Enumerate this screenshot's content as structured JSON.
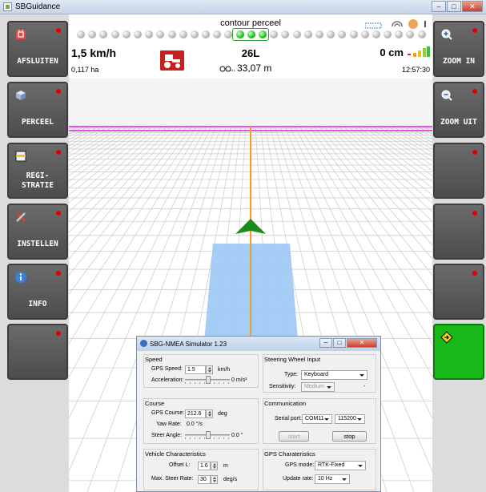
{
  "window": {
    "title": "SBGuidance",
    "min": "–",
    "max": "□",
    "close": "✕"
  },
  "left_buttons": [
    {
      "label": "AFSLUITEN",
      "icon": "exit-icon"
    },
    {
      "label": "PERCEEL",
      "icon": "field-icon"
    },
    {
      "label": "REGI-\nSTRATIE",
      "icon": "register-icon"
    },
    {
      "label": "INSTELLEN",
      "icon": "settings-icon"
    },
    {
      "label": "INFO",
      "icon": "info-icon"
    },
    {
      "label": "",
      "icon": ""
    }
  ],
  "right_buttons": [
    {
      "label": "ZOOM IN",
      "icon": "zoom-in-icon"
    },
    {
      "label": "ZOOM UIT",
      "icon": "zoom-out-icon"
    },
    {
      "label": "",
      "icon": ""
    },
    {
      "label": "",
      "icon": ""
    },
    {
      "label": "",
      "icon": ""
    },
    {
      "label": "",
      "icon": "arrow-diamond-icon",
      "color": "#18b818"
    }
  ],
  "status": {
    "mode_title": "contour perceel",
    "speed": "1,5 km/h",
    "area": "0,117 ha",
    "lane": "26L",
    "distance": "33,07 m",
    "offset": "0 cm",
    "time": "12:57:30",
    "leds_total": 31,
    "leds_active": [
      14,
      15,
      16
    ]
  },
  "colors": {
    "boundary": "#e020e0",
    "guide_line": "#f0a020",
    "coverage": "#9cc8f4",
    "vehicle": "#1d8a1d",
    "button_bg": "#5c5c5c",
    "indicator": "#e00000"
  },
  "dialog": {
    "title": "SBG-NMEA Simulator 1.23",
    "speed": {
      "header": "Speed",
      "gps_speed_label": "GPS Speed:",
      "gps_speed_value": "1.5",
      "gps_speed_unit": "km/h",
      "accel_label": "Acceleration:",
      "accel_value": "0 m/s²"
    },
    "course": {
      "header": "Course",
      "gps_course_label": "GPS Course:",
      "gps_course_value": "212.6",
      "gps_course_unit": "deg",
      "yaw_label": "Yaw Rate:",
      "yaw_value": "0.0 °/s",
      "steer_label": "Steer Angle:",
      "steer_value": "0.0 °"
    },
    "vehicle": {
      "header": "Vehicle Characteristics",
      "offset_label": "Offset L:",
      "offset_value": "1.6",
      "offset_unit": "m",
      "max_steer_label": "Max. Steer Rate:",
      "max_steer_value": "30",
      "max_steer_unit": "deg/s"
    },
    "steering": {
      "header": "Steering Wheel Input",
      "type_label": "Type:",
      "type_value": "Keyboard",
      "sens_label": "Sensitivity:",
      "sens_value": "Medium",
      "dash": "-"
    },
    "comm": {
      "header": "Communication",
      "port_label": "Serial port:",
      "port_value": "COM11",
      "baud_value": "115200",
      "start": "start",
      "stop": "stop"
    },
    "gps": {
      "header": "GPS Charateristics",
      "mode_label": "GPS mode:",
      "mode_value": "RTK-Fixed",
      "rate_label": "Update rate:",
      "rate_value": "10 Hz"
    }
  }
}
